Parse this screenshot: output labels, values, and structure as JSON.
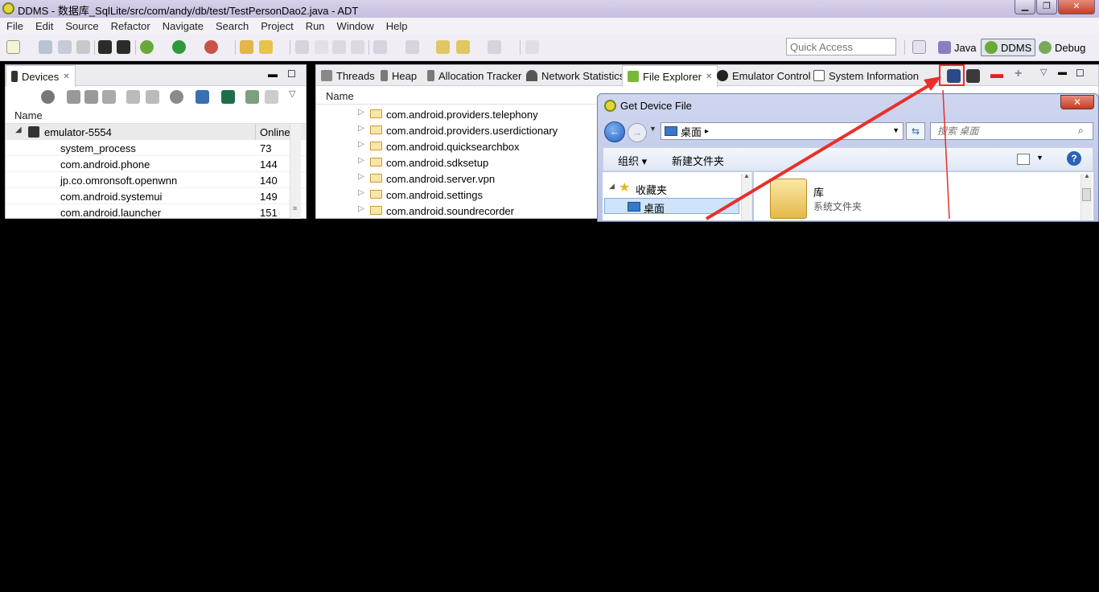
{
  "window": {
    "title": "DDMS - 数据库_SqlLite/src/com/andy/db/test/TestPersonDao2.java - ADT",
    "min_label": "▁",
    "max_label": "❐",
    "close_label": "✕"
  },
  "menu": [
    "File",
    "Edit",
    "Source",
    "Refactor",
    "Navigate",
    "Search",
    "Project",
    "Run",
    "Window",
    "Help"
  ],
  "toolbar": {
    "quick_access_placeholder": "Quick Access",
    "perspectives": [
      {
        "label": "Java"
      },
      {
        "label": "DDMS"
      },
      {
        "label": "Debug"
      }
    ]
  },
  "devices_panel": {
    "tab_label": "Devices",
    "col_name": "Name",
    "device": {
      "name": "emulator-5554",
      "status": "Online"
    },
    "processes": [
      {
        "name": "system_process",
        "pid": "73"
      },
      {
        "name": "com.android.phone",
        "pid": "144"
      },
      {
        "name": "jp.co.omronsoft.openwnn",
        "pid": "140"
      },
      {
        "name": "com.android.systemui",
        "pid": "149"
      },
      {
        "name": "com.android.launcher",
        "pid": "151"
      }
    ]
  },
  "explorer_panel": {
    "tabs": [
      "Threads",
      "Heap",
      "Allocation Tracker",
      "Network Statistics",
      "File Explorer",
      "Emulator Control",
      "System Information"
    ],
    "col_name": "Name",
    "folders": [
      "com.android.providers.telephony",
      "com.android.providers.userdictionary",
      "com.android.quicksearchbox",
      "com.android.sdksetup",
      "com.android.server.vpn",
      "com.android.settings",
      "com.android.soundrecorder"
    ]
  },
  "dialog": {
    "title": "Get Device File",
    "close_label": "✕",
    "address": "桌面",
    "search_placeholder": "搜索 桌面",
    "organize_label": "组织 ▾",
    "new_folder_label": "新建文件夹",
    "nav": {
      "favorites": "收藏夹",
      "desktop": "桌面"
    },
    "library": {
      "name": "库",
      "type": "系统文件夹"
    }
  },
  "colors": {
    "annotation_red": "#e8302a",
    "title_bar": "#cfc5e3"
  }
}
